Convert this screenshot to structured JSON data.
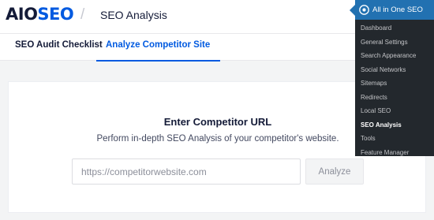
{
  "header": {
    "logo_prefix": "AIO",
    "logo_suffix": "SEO",
    "page_title": "SEO Analysis"
  },
  "tabs": [
    {
      "label": "SEO Audit Checklist",
      "active": false
    },
    {
      "label": "Analyze Competitor Site",
      "active": true
    }
  ],
  "card": {
    "title": "Enter Competitor URL",
    "subtitle": "Perform in-depth SEO Analysis of your competitor's website.",
    "input_placeholder": "https://competitorwebsite.com",
    "input_value": "",
    "button_label": "Analyze"
  },
  "wp_submenu": {
    "title": "All in One SEO",
    "items": [
      {
        "label": "Dashboard",
        "active": false
      },
      {
        "label": "General Settings",
        "active": false
      },
      {
        "label": "Search Appearance",
        "active": false
      },
      {
        "label": "Social Networks",
        "active": false
      },
      {
        "label": "Sitemaps",
        "active": false
      },
      {
        "label": "Redirects",
        "active": false
      },
      {
        "label": "Local SEO",
        "active": false
      },
      {
        "label": "SEO Analysis",
        "active": true
      },
      {
        "label": "Tools",
        "active": false
      },
      {
        "label": "Feature Manager",
        "active": false
      }
    ]
  },
  "colors": {
    "brand_blue": "#005ae0",
    "brand_dark": "#141b38",
    "wp_menu_bg": "#23282d",
    "wp_menu_highlight": "#2271b1"
  }
}
